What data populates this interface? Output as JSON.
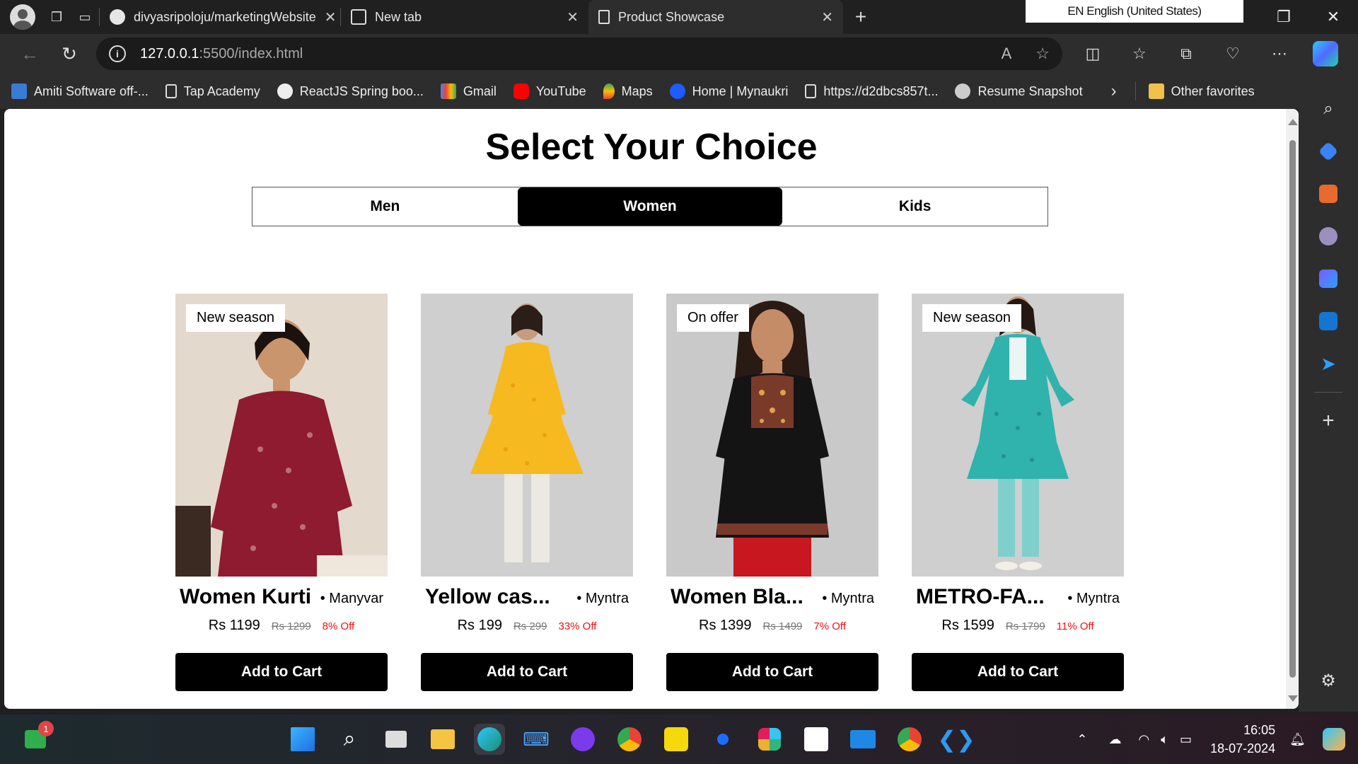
{
  "browser": {
    "tabs": [
      {
        "title": "divyasripoloju/marketingWebsite",
        "active": false
      },
      {
        "title": "New tab",
        "active": false
      },
      {
        "title": "Product Showcase",
        "active": true
      }
    ],
    "language_indicator": "EN English (United States)",
    "url_host": "127.0.0.1",
    "url_path": ":5500/index.html",
    "favorites": [
      "Amiti Software off-...",
      "Tap Academy",
      "ReactJS Spring boo...",
      "Gmail",
      "YouTube",
      "Maps",
      "Home | Mynaukri",
      "https://d2dbcs857t...",
      "Resume Snapshot"
    ],
    "other_favorites": "Other favorites"
  },
  "page": {
    "heading": "Select Your Choice",
    "categories": [
      "Men",
      "Women",
      "Kids"
    ],
    "selected_category": "Women",
    "products": [
      {
        "badge": "New season",
        "name": "Women Kurti",
        "brand": "Manyvar",
        "price": "Rs 1199",
        "mrp": "Rs 1299",
        "discount": "8% Off",
        "cta": "Add to Cart"
      },
      {
        "badge": "",
        "name": "Yellow cas...",
        "brand": "Myntra",
        "price": "Rs 199",
        "mrp": "Rs 299",
        "discount": "33% Off",
        "cta": "Add to Cart"
      },
      {
        "badge": "On offer",
        "name": "Women Bla...",
        "brand": "Myntra",
        "price": "Rs 1399",
        "mrp": "Rs 1499",
        "discount": "7% Off",
        "cta": "Add to Cart"
      },
      {
        "badge": "New season",
        "name": "METRO-FA...",
        "brand": "Myntra",
        "price": "Rs 1599",
        "mrp": "Rs 1799",
        "discount": "11% Off",
        "cta": "Add to Cart"
      }
    ]
  },
  "taskbar": {
    "notification_count": "1",
    "time": "16:05",
    "date": "18-07-2024"
  }
}
